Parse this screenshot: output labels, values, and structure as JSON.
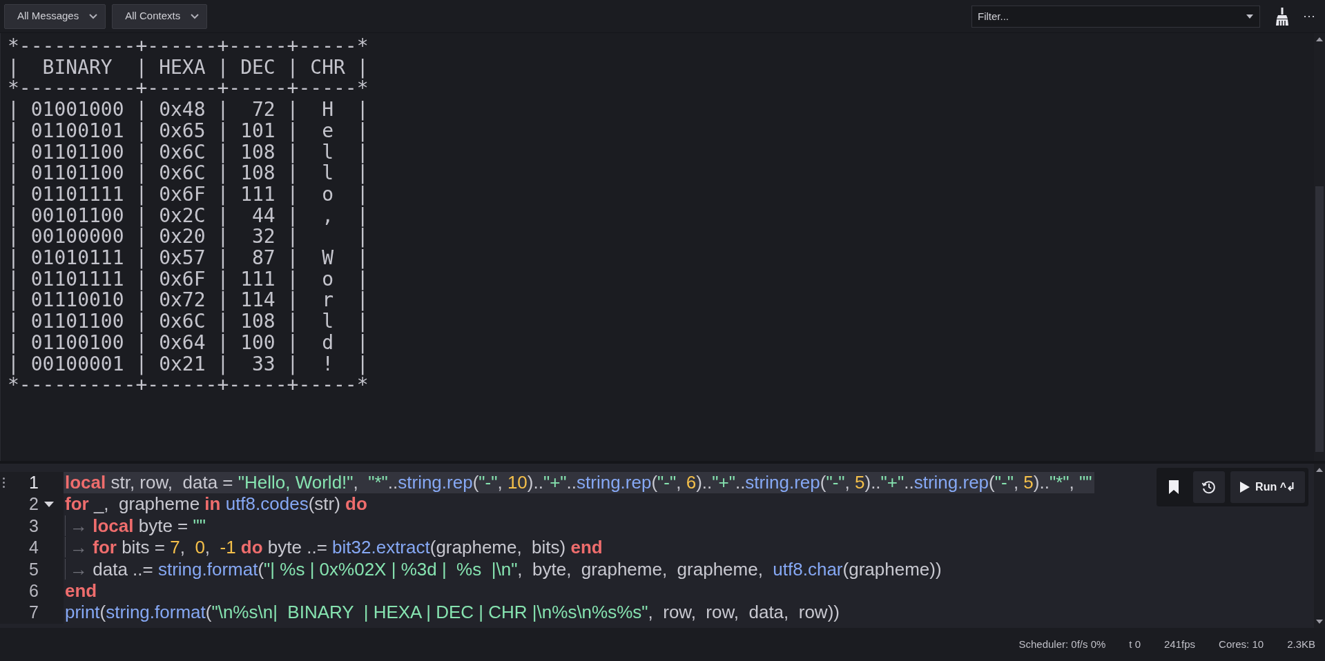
{
  "toolbar": {
    "dropdowns": [
      {
        "label": "All Messages"
      },
      {
        "label": "All Contexts"
      }
    ],
    "filter": {
      "placeholder": "Filter..."
    },
    "more": "···"
  },
  "output": {
    "lines": [
      "*----------+------+-----+-----*",
      "|  BINARY  | HEXA | DEC | CHR |",
      "*----------+------+-----+-----*",
      "| 01001000 | 0x48 |  72 |  H  |",
      "| 01100101 | 0x65 | 101 |  e  |",
      "| 01101100 | 0x6C | 108 |  l  |",
      "| 01101100 | 0x6C | 108 |  l  |",
      "| 01101111 | 0x6F | 111 |  o  |",
      "| 00101100 | 0x2C |  44 |  ,  |",
      "| 00100000 | 0x20 |  32 |     |",
      "| 01010111 | 0x57 |  87 |  W  |",
      "| 01101111 | 0x6F | 111 |  o  |",
      "| 01110010 | 0x72 | 114 |  r  |",
      "| 01101100 | 0x6C | 108 |  l  |",
      "| 01100100 | 0x64 | 100 |  d  |",
      "| 00100001 | 0x21 |  33 |  !  |",
      "*----------+------+-----+-----*"
    ]
  },
  "editor": {
    "lines": [
      {
        "number": "1",
        "current": true,
        "foldable": false,
        "tokens": [
          {
            "kind": "kw",
            "text": "local"
          },
          {
            "kind": "plain",
            "text": " str, row,  data = "
          },
          {
            "kind": "str",
            "text": "\"Hello, World!\""
          },
          {
            "kind": "plain",
            "text": ",  "
          },
          {
            "kind": "str",
            "text": "\"*\""
          },
          {
            "kind": "plain",
            "text": ".."
          },
          {
            "kind": "fn",
            "text": "string.rep"
          },
          {
            "kind": "plain",
            "text": "("
          },
          {
            "kind": "str",
            "text": "\"-\""
          },
          {
            "kind": "plain",
            "text": ", "
          },
          {
            "kind": "num",
            "text": "10"
          },
          {
            "kind": "plain",
            "text": ").."
          },
          {
            "kind": "str",
            "text": "\"+\""
          },
          {
            "kind": "plain",
            "text": ".."
          },
          {
            "kind": "fn",
            "text": "string.rep"
          },
          {
            "kind": "plain",
            "text": "("
          },
          {
            "kind": "str",
            "text": "\"-\""
          },
          {
            "kind": "plain",
            "text": ", "
          },
          {
            "kind": "num",
            "text": "6"
          },
          {
            "kind": "plain",
            "text": ").."
          },
          {
            "kind": "str",
            "text": "\"+\""
          },
          {
            "kind": "plain",
            "text": ".."
          },
          {
            "kind": "fn",
            "text": "string.rep"
          },
          {
            "kind": "plain",
            "text": "("
          },
          {
            "kind": "str",
            "text": "\"-\""
          },
          {
            "kind": "plain",
            "text": ", "
          },
          {
            "kind": "num",
            "text": "5"
          },
          {
            "kind": "plain",
            "text": ").."
          },
          {
            "kind": "str",
            "text": "\"+\""
          },
          {
            "kind": "plain",
            "text": ".."
          },
          {
            "kind": "fn",
            "text": "string.rep"
          },
          {
            "kind": "plain",
            "text": "("
          },
          {
            "kind": "str",
            "text": "\"-\""
          },
          {
            "kind": "plain",
            "text": ", "
          },
          {
            "kind": "num",
            "text": "5"
          },
          {
            "kind": "plain",
            "text": ").."
          },
          {
            "kind": "str",
            "text": "\"*\""
          },
          {
            "kind": "plain",
            "text": ", "
          },
          {
            "kind": "str",
            "text": "\"\""
          }
        ]
      },
      {
        "number": "2",
        "current": false,
        "foldable": true,
        "tokens": [
          {
            "kind": "kw",
            "text": "for"
          },
          {
            "kind": "plain",
            "text": " _,  grapheme "
          },
          {
            "kind": "kw",
            "text": "in "
          },
          {
            "kind": "fn",
            "text": "utf8.codes"
          },
          {
            "kind": "plain",
            "text": "(str) "
          },
          {
            "kind": "kw",
            "text": "do"
          }
        ]
      },
      {
        "number": "3",
        "current": false,
        "foldable": false,
        "tokens": [
          {
            "kind": "tab",
            "text": "→ "
          },
          {
            "kind": "kw",
            "text": "local"
          },
          {
            "kind": "plain",
            "text": " byte = "
          },
          {
            "kind": "str",
            "text": "\"\""
          }
        ]
      },
      {
        "number": "4",
        "current": false,
        "foldable": false,
        "tokens": [
          {
            "kind": "tab",
            "text": "→ "
          },
          {
            "kind": "kw",
            "text": "for"
          },
          {
            "kind": "plain",
            "text": " bits = "
          },
          {
            "kind": "num",
            "text": "7"
          },
          {
            "kind": "plain",
            "text": ",  "
          },
          {
            "kind": "num",
            "text": "0"
          },
          {
            "kind": "plain",
            "text": ",  "
          },
          {
            "kind": "num",
            "text": "-1 "
          },
          {
            "kind": "kw",
            "text": "do"
          },
          {
            "kind": "plain",
            "text": " byte ..= "
          },
          {
            "kind": "fn",
            "text": "bit32.extract"
          },
          {
            "kind": "plain",
            "text": "(grapheme,  bits) "
          },
          {
            "kind": "kw",
            "text": "end"
          }
        ]
      },
      {
        "number": "5",
        "current": false,
        "foldable": false,
        "tokens": [
          {
            "kind": "tab",
            "text": "→ "
          },
          {
            "kind": "plain",
            "text": "data ..= "
          },
          {
            "kind": "fn",
            "text": "string.format"
          },
          {
            "kind": "plain",
            "text": "("
          },
          {
            "kind": "str",
            "text": "\"| %s | 0x%02X | %3d |  %s  |\\n\""
          },
          {
            "kind": "plain",
            "text": ",  byte,  grapheme,  grapheme,  "
          },
          {
            "kind": "fn",
            "text": "utf8.char"
          },
          {
            "kind": "plain",
            "text": "(grapheme))"
          }
        ]
      },
      {
        "number": "6",
        "current": false,
        "foldable": false,
        "tokens": [
          {
            "kind": "kw",
            "text": "end"
          }
        ]
      },
      {
        "number": "7",
        "current": false,
        "foldable": false,
        "tokens": [
          {
            "kind": "fn",
            "text": "print"
          },
          {
            "kind": "plain",
            "text": "("
          },
          {
            "kind": "fn",
            "text": "string.format"
          },
          {
            "kind": "plain",
            "text": "("
          },
          {
            "kind": "str",
            "text": "\"\\n%s\\n|  BINARY  | HEXA | DEC | CHR |\\n%s\\n%s%s\""
          },
          {
            "kind": "plain",
            "text": ",  row,  row,  data,  row))"
          }
        ]
      }
    ],
    "run_bar": {
      "run_label": "Run",
      "shortcut": "^↲"
    }
  },
  "status_bar": [
    "Scheduler: 0f/s 0%",
    "t 0",
    "241fps",
    "Cores: 10",
    "2.3KB"
  ]
}
